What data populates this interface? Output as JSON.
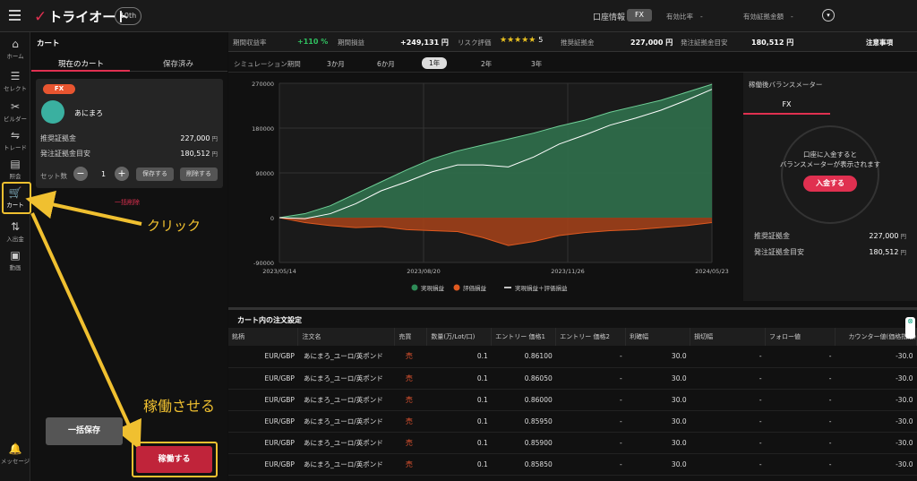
{
  "header": {
    "logo": "トライオート",
    "anniversary": "10th",
    "account_info": "口座情報",
    "account_type": "FX",
    "margin_ratio_label": "有効比率",
    "effective_margin_label": "有効証拠金額"
  },
  "nav": [
    {
      "label": "ホーム",
      "icon": "home-icon"
    },
    {
      "label": "セレクト",
      "icon": "select-icon"
    },
    {
      "label": "ビルダー",
      "icon": "tools-icon"
    },
    {
      "label": "トレード",
      "icon": "trade-icon"
    },
    {
      "label": "照会",
      "icon": "list-icon"
    },
    {
      "label": "カート",
      "icon": "cart-icon",
      "badge": "1"
    },
    {
      "label": "入出金",
      "icon": "transfer-icon"
    },
    {
      "label": "動画",
      "icon": "video-icon"
    },
    {
      "label": "メッセージ",
      "icon": "bell-icon"
    }
  ],
  "cart": {
    "title": "カート",
    "tab_current": "現在のカート",
    "tab_saved": "保存済み",
    "item": {
      "tag": "FX",
      "name": "あにまろ",
      "required_margin_label": "推奨証拠金",
      "required_margin": "227,000",
      "order_margin_label": "発注証拠金目安",
      "order_margin": "180,512",
      "currency": "円",
      "set_label": "セット数",
      "set_count": "1",
      "save_btn": "保存する",
      "delete_btn": "削除する"
    },
    "delete_all": "一括削除",
    "save_all": "一括保存",
    "launch": "稼働する"
  },
  "annotations": {
    "click": "クリック",
    "launch": "稼働させる"
  },
  "stats": {
    "period_return_label": "期間収益率",
    "period_return": "+110 %",
    "period_pl_label": "期間損益",
    "period_pl": "+249,131 円",
    "risk_label": "リスク評価",
    "risk_stars": "★★★★★",
    "risk_value": "5",
    "margin_label": "推奨証拠金",
    "margin": "227,000 円",
    "order_margin_label": "発注証拠金目安",
    "order_margin": "180,512 円",
    "notice": "注意事項"
  },
  "period": {
    "label": "シミュレーション期間",
    "options": [
      "3か月",
      "6か月",
      "1年",
      "2年",
      "3年"
    ],
    "selected": "1年"
  },
  "chart_data": {
    "type": "area",
    "x_ticks": [
      "2023/05/14",
      "2023/08/20",
      "2023/11/26",
      "2024/05/23"
    ],
    "y_ticks": [
      "270000",
      "180000",
      "90000",
      "0",
      "-90000"
    ],
    "ylim": [
      -90000,
      270000
    ],
    "legend": [
      "実現損益",
      "評価損益",
      "実現損益＋評価損益"
    ],
    "colors": {
      "realized": "#2e6b4a",
      "unrealized": "#a0401a",
      "total": "#ffffff"
    },
    "realized": [
      0,
      8000,
      24000,
      48000,
      72000,
      96000,
      118000,
      134000,
      146000,
      158000,
      170000,
      184000,
      196000,
      212000,
      224000,
      236000,
      252000,
      268000
    ],
    "unrealized": [
      0,
      -10000,
      -16000,
      -20000,
      -18000,
      -24000,
      -26000,
      -28000,
      -40000,
      -56000,
      -48000,
      -36000,
      -30000,
      -26000,
      -24000,
      -20000,
      -16000,
      -10000
    ],
    "total": [
      0,
      -2000,
      8000,
      28000,
      54000,
      72000,
      92000,
      106000,
      106000,
      102000,
      122000,
      148000,
      166000,
      186000,
      200000,
      216000,
      236000,
      258000
    ]
  },
  "balance_meter": {
    "title": "稼働後バランスメーター",
    "tab": "FX",
    "msg1": "口座に入金すると",
    "msg2": "バランスメーターが表示されます",
    "deposit": "入金する",
    "margin_label": "推奨証拠金",
    "margin": "227,000",
    "order_label": "発注証拠金目安",
    "order": "180,512",
    "currency": "円"
  },
  "orders": {
    "title": "カート内の注文設定",
    "columns": [
      "銘柄",
      "注文名",
      "売買",
      "数量(万/Lot/口)",
      "エントリー 価格1",
      "エントリー 価格2",
      "利確幅",
      "損切幅",
      "フォロー値",
      "カウンター値(価格指定)"
    ],
    "rows": [
      [
        "EUR/GBP",
        "あにまろ_ユーロ/英ポンド",
        "売",
        "0.1",
        "0.86100",
        "-",
        "30.0",
        "-",
        "-",
        "-30.0"
      ],
      [
        "EUR/GBP",
        "あにまろ_ユーロ/英ポンド",
        "売",
        "0.1",
        "0.86050",
        "-",
        "30.0",
        "-",
        "-",
        "-30.0"
      ],
      [
        "EUR/GBP",
        "あにまろ_ユーロ/英ポンド",
        "売",
        "0.1",
        "0.86000",
        "-",
        "30.0",
        "-",
        "-",
        "-30.0"
      ],
      [
        "EUR/GBP",
        "あにまろ_ユーロ/英ポンド",
        "売",
        "0.1",
        "0.85950",
        "-",
        "30.0",
        "-",
        "-",
        "-30.0"
      ],
      [
        "EUR/GBP",
        "あにまろ_ユーロ/英ポンド",
        "売",
        "0.1",
        "0.85900",
        "-",
        "30.0",
        "-",
        "-",
        "-30.0"
      ],
      [
        "EUR/GBP",
        "あにまろ_ユーロ/英ポンド",
        "売",
        "0.1",
        "0.85850",
        "-",
        "30.0",
        "-",
        "-",
        "-30.0"
      ]
    ]
  }
}
